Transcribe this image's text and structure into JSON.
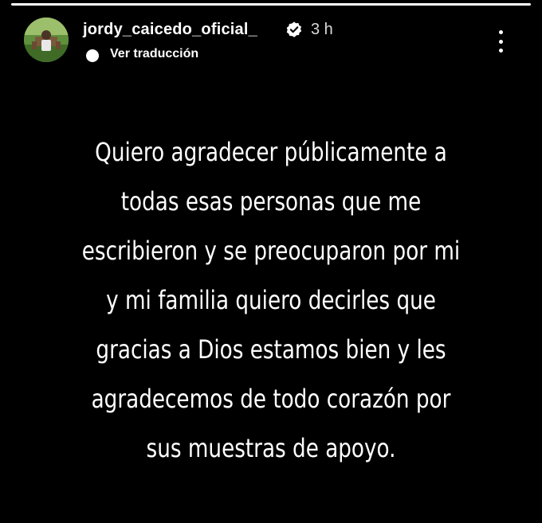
{
  "story": {
    "progress": 1.0,
    "username": "jordy_caicedo_oficial_",
    "verified": true,
    "timestamp": "3 h",
    "translate_label": "Ver traducción",
    "icons": {
      "avatar": "profile-avatar",
      "verified": "verified-badge-icon",
      "translate": "translate-icon",
      "more": "more-options-icon"
    },
    "text_lines": [
      "Quiero agradecer públicamente  a",
      "todas esas personas que me",
      "escribieron y se preocuparon por mi",
      "y mi familia quiero decirles que",
      "gracias a Dios estamos bien y les",
      "agradecemos de todo corazón por",
      "sus muestras de apoyo."
    ]
  },
  "colors": {
    "background": "#000000",
    "text": "#ffffff",
    "muted": "#d9d9d9"
  }
}
